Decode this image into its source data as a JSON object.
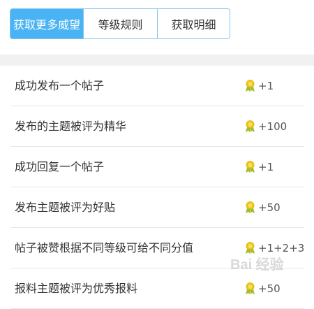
{
  "tabs": [
    {
      "label": "获取更多威望",
      "active": true
    },
    {
      "label": "等级规则",
      "active": false
    },
    {
      "label": "获取明细",
      "active": false
    }
  ],
  "rules": [
    {
      "label": "成功发布一个帖子",
      "points": "+1"
    },
    {
      "label": "发布的主题被评为精华",
      "points": "+100"
    },
    {
      "label": "成功回复一个帖子",
      "points": "+1"
    },
    {
      "label": "发布主题被评为好贴",
      "points": "+50"
    },
    {
      "label": "帖子被赞根据不同等级可给不同分值",
      "points": "+1+2+3"
    },
    {
      "label": "报料主题被评为优秀报料",
      "points": "+50"
    }
  ],
  "icons": {
    "points": "medal-icon"
  },
  "colors": {
    "accent": "#4ab3f4",
    "medal": "#e7c21a",
    "medal_ribbon": "#a3bd2b"
  },
  "watermark": "Bai 经验"
}
